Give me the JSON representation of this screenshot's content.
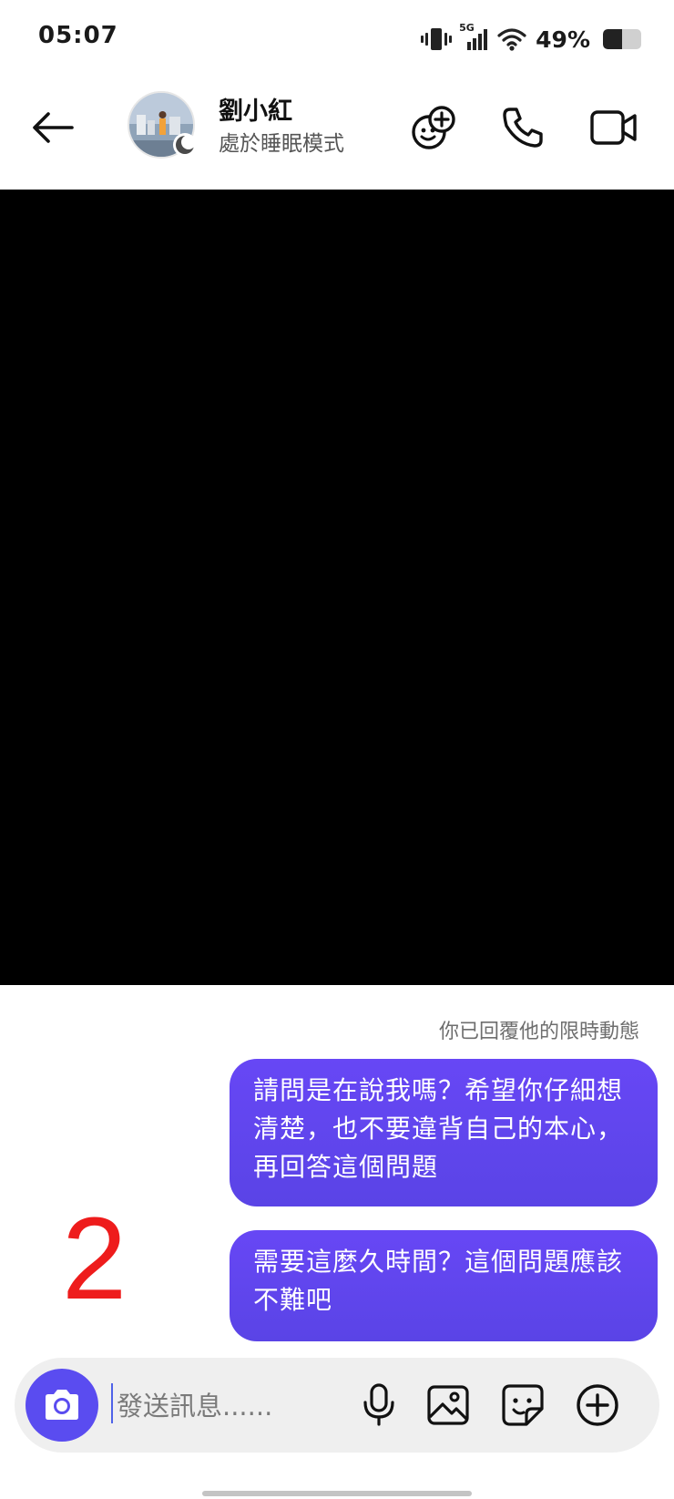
{
  "status_bar": {
    "time": "05:07",
    "network_label": "5G",
    "battery_percent_text": "49%",
    "battery_level": 0.49
  },
  "header": {
    "contact_name": "劉小紅",
    "contact_status": "處於睡眠模式",
    "icons": [
      "back-arrow-icon",
      "games-icon",
      "phone-icon",
      "video-camera-icon"
    ]
  },
  "chat": {
    "story_reply_note": "你已回覆他的限時動態",
    "messages": [
      {
        "sender": "me",
        "text": "請問是在說我嗎？希望你仔細想清楚，也不要違背自己的本心，再回答這個問題"
      },
      {
        "sender": "me",
        "text": "需要這麼久時間？這個問題應該不難吧"
      }
    ],
    "annotation_mark": "2"
  },
  "composer": {
    "placeholder": "發送訊息......",
    "value": "",
    "icons": [
      "camera-icon",
      "microphone-icon",
      "image-icon",
      "sticker-icon",
      "add-icon"
    ]
  },
  "colors": {
    "bubble": "#6747f5",
    "camera_button": "#5a4cf0",
    "annotation": "#ee1c1c"
  }
}
